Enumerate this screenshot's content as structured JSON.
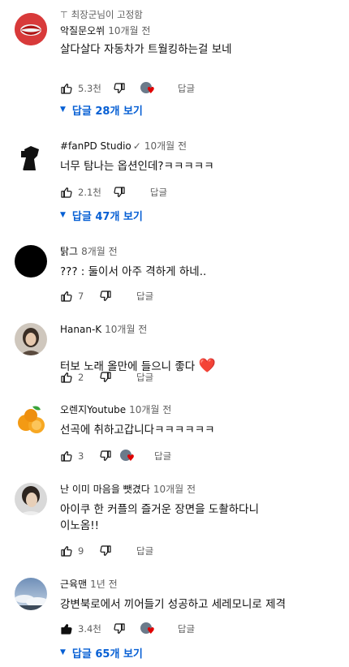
{
  "comments": [
    {
      "pinned_label": "최장군님이 고정함",
      "author": "악질문오쒸",
      "time": "10개월 전",
      "text": "살다살다 자동차가 트월킹하는걸 보네",
      "likes": "5.3천",
      "reply_label": "답글",
      "more_replies": "답글 28개 보기",
      "avatar": "red-lips-avatar"
    },
    {
      "author": "#fanPD Studio",
      "verified": "✓",
      "time": "10개월 전",
      "text": "너무 탐나는 옵션인데?ㅋㅋㅋㅋㅋ",
      "likes": "2.1천",
      "reply_label": "답글",
      "more_replies": "답글 47개 보기",
      "avatar": "camera-man-silhouette-avatar"
    },
    {
      "author": "탉그",
      "time": "8개월 전",
      "text": "??? : 둘이서 아주 격하게 하네..",
      "likes": "7",
      "reply_label": "답글",
      "avatar": "black-circle-avatar"
    },
    {
      "author": "Hanan-K",
      "time": "10개월 전",
      "text": "터보 노래 올만에 들으니 좋다",
      "emoji": "❤️",
      "likes": "2",
      "reply_label": "답글",
      "avatar": "woman-photo-avatar"
    },
    {
      "author": "오렌지Youtube",
      "time": "10개월 전",
      "text": "선곡에 취하고갑니다ㅋㅋㅋㅋㅋㅋ",
      "likes": "3",
      "reply_label": "답글",
      "avatar": "oranges-avatar"
    },
    {
      "author": "난 이미 마음을 뺏겼다",
      "time": "10개월 전",
      "text": "아이쿠 한 커플의 즐거운 장면을 도촬하다니\n이노옴!!",
      "likes": "9",
      "reply_label": "답글",
      "avatar": "man-photo-avatar"
    },
    {
      "author": "근육맨",
      "time": "1년 전",
      "text": "강변북로에서 끼어들기 성공하고 세레모니로 제격",
      "likes": "3.4천",
      "reply_label": "답글",
      "more_replies": "답글 65개 보기",
      "avatar": "sky-clouds-avatar"
    }
  ],
  "colors": {
    "link_blue": "#065fd4",
    "meta_gray": "#606060",
    "heart_red": "#e00000"
  }
}
